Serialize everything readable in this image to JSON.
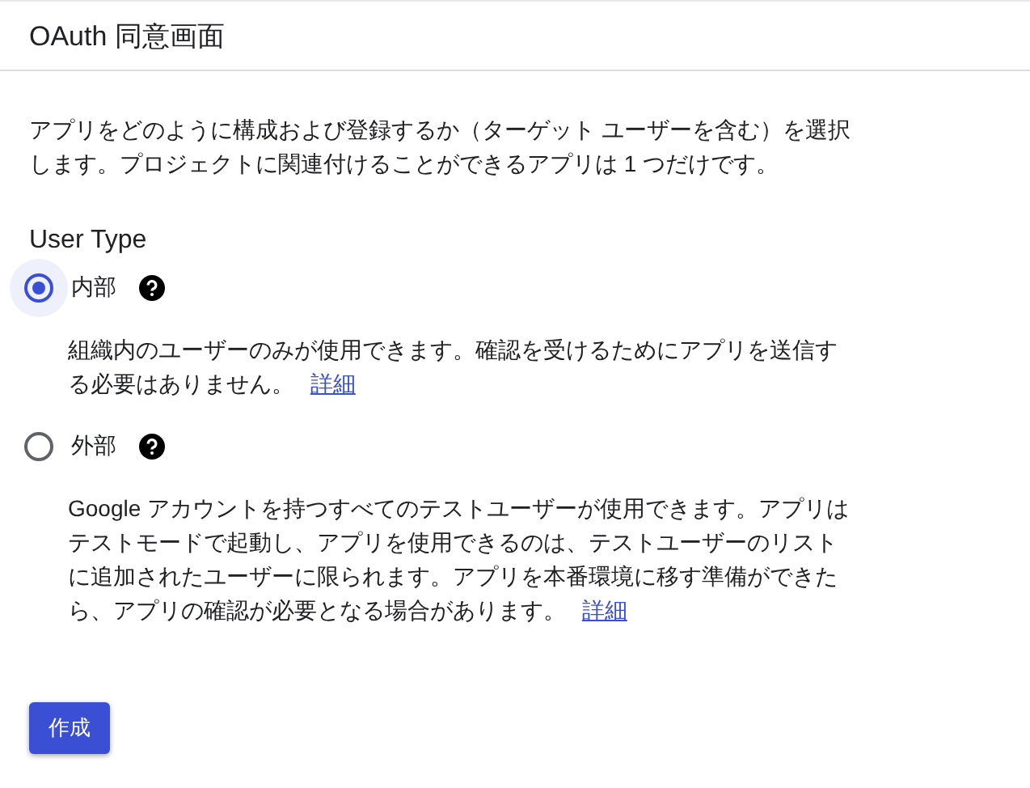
{
  "header": {
    "title": "OAuth 同意画面"
  },
  "intro": "アプリをどのように構成および登録するか（ターゲット ユーザーを含む）を選択します。プロジェクトに関連付けることができるアプリは 1 つだけです。",
  "section_title": "User Type",
  "options": [
    {
      "label": "内部",
      "selected": true,
      "description": "組織内のユーザーのみが使用できます。確認を受けるためにアプリを送信する必要はありません。",
      "link": "詳細"
    },
    {
      "label": "外部",
      "selected": false,
      "description": "Google アカウントを持つすべてのテストユーザーが使用できます。アプリはテストモードで起動し、アプリを使用できるのは、テストユーザーのリストに追加されたユーザーに限られます。アプリを本番環境に移す準備ができたら、アプリの確認が必要となる場合があります。",
      "link": "詳細"
    }
  ],
  "button": "作成"
}
